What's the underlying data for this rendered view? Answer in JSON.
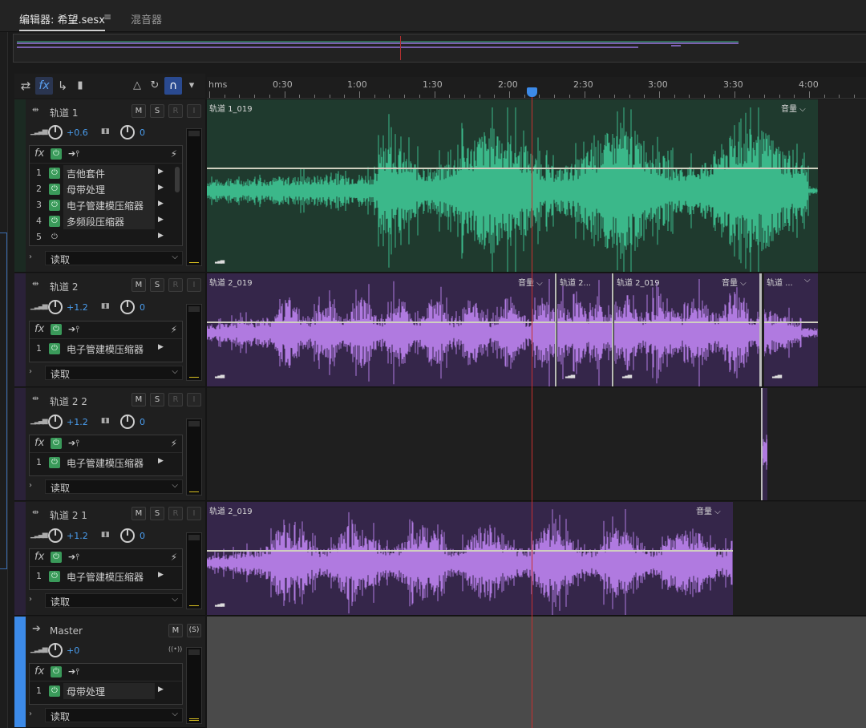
{
  "tabs": {
    "editor": "编辑器: 希望.sesx",
    "menu_icon": "≡",
    "mixer": "混音器"
  },
  "toolbar": {
    "icons": [
      "swap-icon",
      "fx-icon",
      "sends-icon",
      "eq-icon",
      "metronome-icon",
      "loop-icon",
      "snap-magnet-icon",
      "marker-icon"
    ]
  },
  "ruler": {
    "unit": "hms",
    "ticks": [
      "0:30",
      "1:00",
      "1:30",
      "2:00",
      "2:30",
      "3:00",
      "3:30",
      "4:00"
    ]
  },
  "tracks": [
    {
      "name": "轨道 1",
      "m": "M",
      "s": "S",
      "r": "R",
      "i": "I",
      "volume": "+0.6",
      "pan": "0",
      "effects": [
        {
          "num": "1",
          "name": "吉他套件",
          "on": true
        },
        {
          "num": "2",
          "name": "母带处理",
          "on": true
        },
        {
          "num": "3",
          "name": "电子管建模压缩器",
          "on": true
        },
        {
          "num": "4",
          "name": "多频段压缩器",
          "on": true
        },
        {
          "num": "5",
          "name": "",
          "on": false
        }
      ],
      "automation": "读取",
      "clip_names": [
        "轨道 1_019"
      ],
      "clip_vol": "音量",
      "color": "#1f3a2e",
      "wave_color": "#3bb88a"
    },
    {
      "name": "轨道 2",
      "m": "M",
      "s": "S",
      "r": "R",
      "i": "I",
      "volume": "+1.2",
      "pan": "0",
      "effects": [
        {
          "num": "1",
          "name": "电子管建模压缩器",
          "on": true
        }
      ],
      "automation": "读取",
      "clip_names": [
        "轨道 2_019",
        "轨道 2...",
        "轨道 2_019",
        "轨道 ..."
      ],
      "clip_vol": "音量",
      "color": "#35264a",
      "wave_color": "#b07ae0"
    },
    {
      "name": "轨道 2 2",
      "m": "M",
      "s": "S",
      "r": "R",
      "i": "I",
      "volume": "+1.2",
      "pan": "0",
      "effects": [
        {
          "num": "1",
          "name": "电子管建模压缩器",
          "on": true
        }
      ],
      "automation": "读取",
      "clip_names": [],
      "color": "#35264a",
      "wave_color": "#b07ae0"
    },
    {
      "name": "轨道 2 1",
      "m": "M",
      "s": "S",
      "r": "R",
      "i": "I",
      "volume": "+1.2",
      "pan": "0",
      "effects": [
        {
          "num": "1",
          "name": "电子管建模压缩器",
          "on": true
        }
      ],
      "automation": "读取",
      "clip_names": [
        "轨道 2_019"
      ],
      "clip_vol": "音量",
      "color": "#35264a",
      "wave_color": "#b07ae0"
    }
  ],
  "master": {
    "name": "Master",
    "m": "M",
    "s": "(S)",
    "volume": "+0",
    "effects": [
      {
        "num": "1",
        "name": "母带处理",
        "on": true
      }
    ],
    "automation": "读取"
  },
  "playhead_time": "2:04",
  "colors": {
    "accent": "#4a9ef0",
    "playhead": "#c83030",
    "track1_clip": "#1f3a2e",
    "track2_clip": "#35264a",
    "master_stripe": "#3c8ae8"
  }
}
